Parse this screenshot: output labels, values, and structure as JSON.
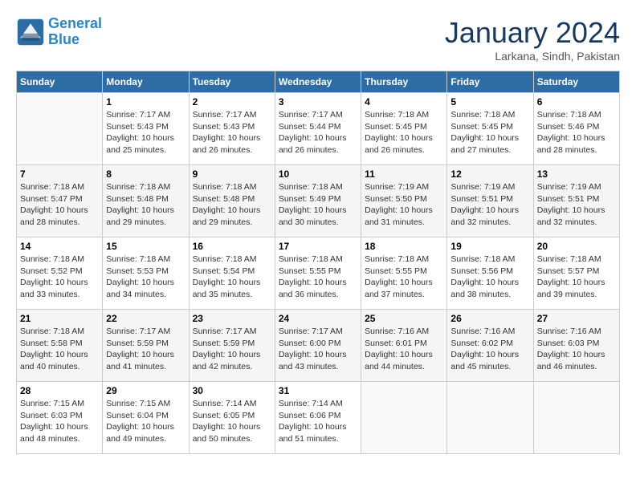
{
  "header": {
    "logo_line1": "General",
    "logo_line2": "Blue",
    "month_year": "January 2024",
    "location": "Larkana, Sindh, Pakistan"
  },
  "weekdays": [
    "Sunday",
    "Monday",
    "Tuesday",
    "Wednesday",
    "Thursday",
    "Friday",
    "Saturday"
  ],
  "weeks": [
    [
      {
        "day": "",
        "sunrise": "",
        "sunset": "",
        "daylight": ""
      },
      {
        "day": "1",
        "sunrise": "Sunrise: 7:17 AM",
        "sunset": "Sunset: 5:43 PM",
        "daylight": "Daylight: 10 hours and 25 minutes."
      },
      {
        "day": "2",
        "sunrise": "Sunrise: 7:17 AM",
        "sunset": "Sunset: 5:43 PM",
        "daylight": "Daylight: 10 hours and 26 minutes."
      },
      {
        "day": "3",
        "sunrise": "Sunrise: 7:17 AM",
        "sunset": "Sunset: 5:44 PM",
        "daylight": "Daylight: 10 hours and 26 minutes."
      },
      {
        "day": "4",
        "sunrise": "Sunrise: 7:18 AM",
        "sunset": "Sunset: 5:45 PM",
        "daylight": "Daylight: 10 hours and 26 minutes."
      },
      {
        "day": "5",
        "sunrise": "Sunrise: 7:18 AM",
        "sunset": "Sunset: 5:45 PM",
        "daylight": "Daylight: 10 hours and 27 minutes."
      },
      {
        "day": "6",
        "sunrise": "Sunrise: 7:18 AM",
        "sunset": "Sunset: 5:46 PM",
        "daylight": "Daylight: 10 hours and 28 minutes."
      }
    ],
    [
      {
        "day": "7",
        "sunrise": "Sunrise: 7:18 AM",
        "sunset": "Sunset: 5:47 PM",
        "daylight": "Daylight: 10 hours and 28 minutes."
      },
      {
        "day": "8",
        "sunrise": "Sunrise: 7:18 AM",
        "sunset": "Sunset: 5:48 PM",
        "daylight": "Daylight: 10 hours and 29 minutes."
      },
      {
        "day": "9",
        "sunrise": "Sunrise: 7:18 AM",
        "sunset": "Sunset: 5:48 PM",
        "daylight": "Daylight: 10 hours and 29 minutes."
      },
      {
        "day": "10",
        "sunrise": "Sunrise: 7:18 AM",
        "sunset": "Sunset: 5:49 PM",
        "daylight": "Daylight: 10 hours and 30 minutes."
      },
      {
        "day": "11",
        "sunrise": "Sunrise: 7:19 AM",
        "sunset": "Sunset: 5:50 PM",
        "daylight": "Daylight: 10 hours and 31 minutes."
      },
      {
        "day": "12",
        "sunrise": "Sunrise: 7:19 AM",
        "sunset": "Sunset: 5:51 PM",
        "daylight": "Daylight: 10 hours and 32 minutes."
      },
      {
        "day": "13",
        "sunrise": "Sunrise: 7:19 AM",
        "sunset": "Sunset: 5:51 PM",
        "daylight": "Daylight: 10 hours and 32 minutes."
      }
    ],
    [
      {
        "day": "14",
        "sunrise": "Sunrise: 7:18 AM",
        "sunset": "Sunset: 5:52 PM",
        "daylight": "Daylight: 10 hours and 33 minutes."
      },
      {
        "day": "15",
        "sunrise": "Sunrise: 7:18 AM",
        "sunset": "Sunset: 5:53 PM",
        "daylight": "Daylight: 10 hours and 34 minutes."
      },
      {
        "day": "16",
        "sunrise": "Sunrise: 7:18 AM",
        "sunset": "Sunset: 5:54 PM",
        "daylight": "Daylight: 10 hours and 35 minutes."
      },
      {
        "day": "17",
        "sunrise": "Sunrise: 7:18 AM",
        "sunset": "Sunset: 5:55 PM",
        "daylight": "Daylight: 10 hours and 36 minutes."
      },
      {
        "day": "18",
        "sunrise": "Sunrise: 7:18 AM",
        "sunset": "Sunset: 5:55 PM",
        "daylight": "Daylight: 10 hours and 37 minutes."
      },
      {
        "day": "19",
        "sunrise": "Sunrise: 7:18 AM",
        "sunset": "Sunset: 5:56 PM",
        "daylight": "Daylight: 10 hours and 38 minutes."
      },
      {
        "day": "20",
        "sunrise": "Sunrise: 7:18 AM",
        "sunset": "Sunset: 5:57 PM",
        "daylight": "Daylight: 10 hours and 39 minutes."
      }
    ],
    [
      {
        "day": "21",
        "sunrise": "Sunrise: 7:18 AM",
        "sunset": "Sunset: 5:58 PM",
        "daylight": "Daylight: 10 hours and 40 minutes."
      },
      {
        "day": "22",
        "sunrise": "Sunrise: 7:17 AM",
        "sunset": "Sunset: 5:59 PM",
        "daylight": "Daylight: 10 hours and 41 minutes."
      },
      {
        "day": "23",
        "sunrise": "Sunrise: 7:17 AM",
        "sunset": "Sunset: 5:59 PM",
        "daylight": "Daylight: 10 hours and 42 minutes."
      },
      {
        "day": "24",
        "sunrise": "Sunrise: 7:17 AM",
        "sunset": "Sunset: 6:00 PM",
        "daylight": "Daylight: 10 hours and 43 minutes."
      },
      {
        "day": "25",
        "sunrise": "Sunrise: 7:16 AM",
        "sunset": "Sunset: 6:01 PM",
        "daylight": "Daylight: 10 hours and 44 minutes."
      },
      {
        "day": "26",
        "sunrise": "Sunrise: 7:16 AM",
        "sunset": "Sunset: 6:02 PM",
        "daylight": "Daylight: 10 hours and 45 minutes."
      },
      {
        "day": "27",
        "sunrise": "Sunrise: 7:16 AM",
        "sunset": "Sunset: 6:03 PM",
        "daylight": "Daylight: 10 hours and 46 minutes."
      }
    ],
    [
      {
        "day": "28",
        "sunrise": "Sunrise: 7:15 AM",
        "sunset": "Sunset: 6:03 PM",
        "daylight": "Daylight: 10 hours and 48 minutes."
      },
      {
        "day": "29",
        "sunrise": "Sunrise: 7:15 AM",
        "sunset": "Sunset: 6:04 PM",
        "daylight": "Daylight: 10 hours and 49 minutes."
      },
      {
        "day": "30",
        "sunrise": "Sunrise: 7:14 AM",
        "sunset": "Sunset: 6:05 PM",
        "daylight": "Daylight: 10 hours and 50 minutes."
      },
      {
        "day": "31",
        "sunrise": "Sunrise: 7:14 AM",
        "sunset": "Sunset: 6:06 PM",
        "daylight": "Daylight: 10 hours and 51 minutes."
      },
      {
        "day": "",
        "sunrise": "",
        "sunset": "",
        "daylight": ""
      },
      {
        "day": "",
        "sunrise": "",
        "sunset": "",
        "daylight": ""
      },
      {
        "day": "",
        "sunrise": "",
        "sunset": "",
        "daylight": ""
      }
    ]
  ]
}
